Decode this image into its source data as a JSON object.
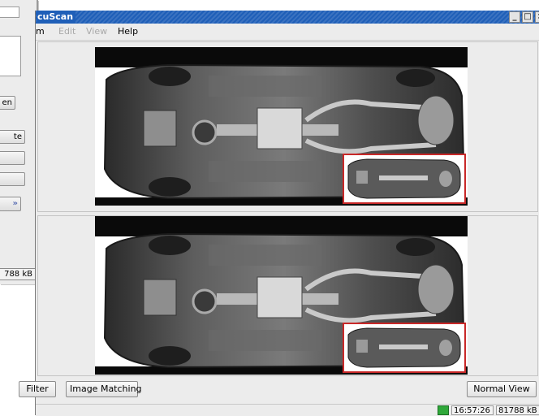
{
  "background_window": {
    "buttons": [
      "en",
      "te",
      "",
      ""
    ],
    "status_text": "788 kB"
  },
  "window": {
    "title": "cuScan",
    "controls": [
      "_",
      "□",
      "×"
    ]
  },
  "menu": {
    "items": [
      {
        "label": "m",
        "enabled": true
      },
      {
        "label": "Edit",
        "enabled": false
      },
      {
        "label": "View",
        "enabled": false
      },
      {
        "label": "Help",
        "enabled": true
      }
    ]
  },
  "panes": [
    {
      "name": "reference-scan",
      "thumbnail_border_color": "#c82828"
    },
    {
      "name": "current-scan",
      "thumbnail_border_color": "#c82828"
    }
  ],
  "toolbar": {
    "filter_label": "Filter",
    "image_matching_label": "Image Matching",
    "normal_view_label": "Normal View"
  },
  "status": {
    "time": "16:57:26",
    "memory": "81788 kB"
  },
  "colors": {
    "titlebar": "#1f5fb8",
    "status_indicator": "#2fa83a"
  }
}
